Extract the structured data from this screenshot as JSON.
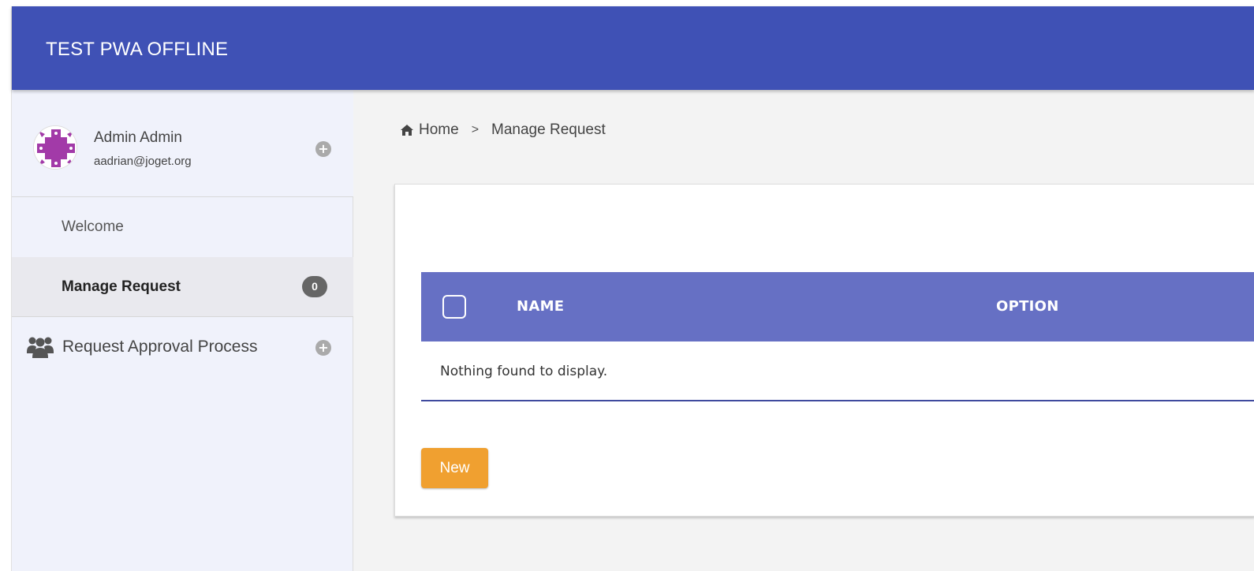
{
  "app": {
    "title": "TEST PWA OFFLINE"
  },
  "profile": {
    "name": "Admin Admin",
    "email": "aadrian@joget.org",
    "expand_icon": "plus-circle-icon"
  },
  "sidebar": {
    "items": [
      {
        "label": "Welcome"
      },
      {
        "label": "Manage Request",
        "badge": "0",
        "active": true
      },
      {
        "label": "Request Approval Process",
        "icon": "group-icon",
        "expand_icon": "plus-circle-icon"
      }
    ]
  },
  "breadcrumb": {
    "home": "Home",
    "separator": ">",
    "current": "Manage Request"
  },
  "table": {
    "columns": [
      "NAME",
      "OPTION"
    ],
    "empty_message": "Nothing found to display."
  },
  "actions": {
    "new_label": "New"
  },
  "colors": {
    "header": "#3f51b5",
    "table_header": "#6670c4",
    "new_button": "#f0a030"
  }
}
